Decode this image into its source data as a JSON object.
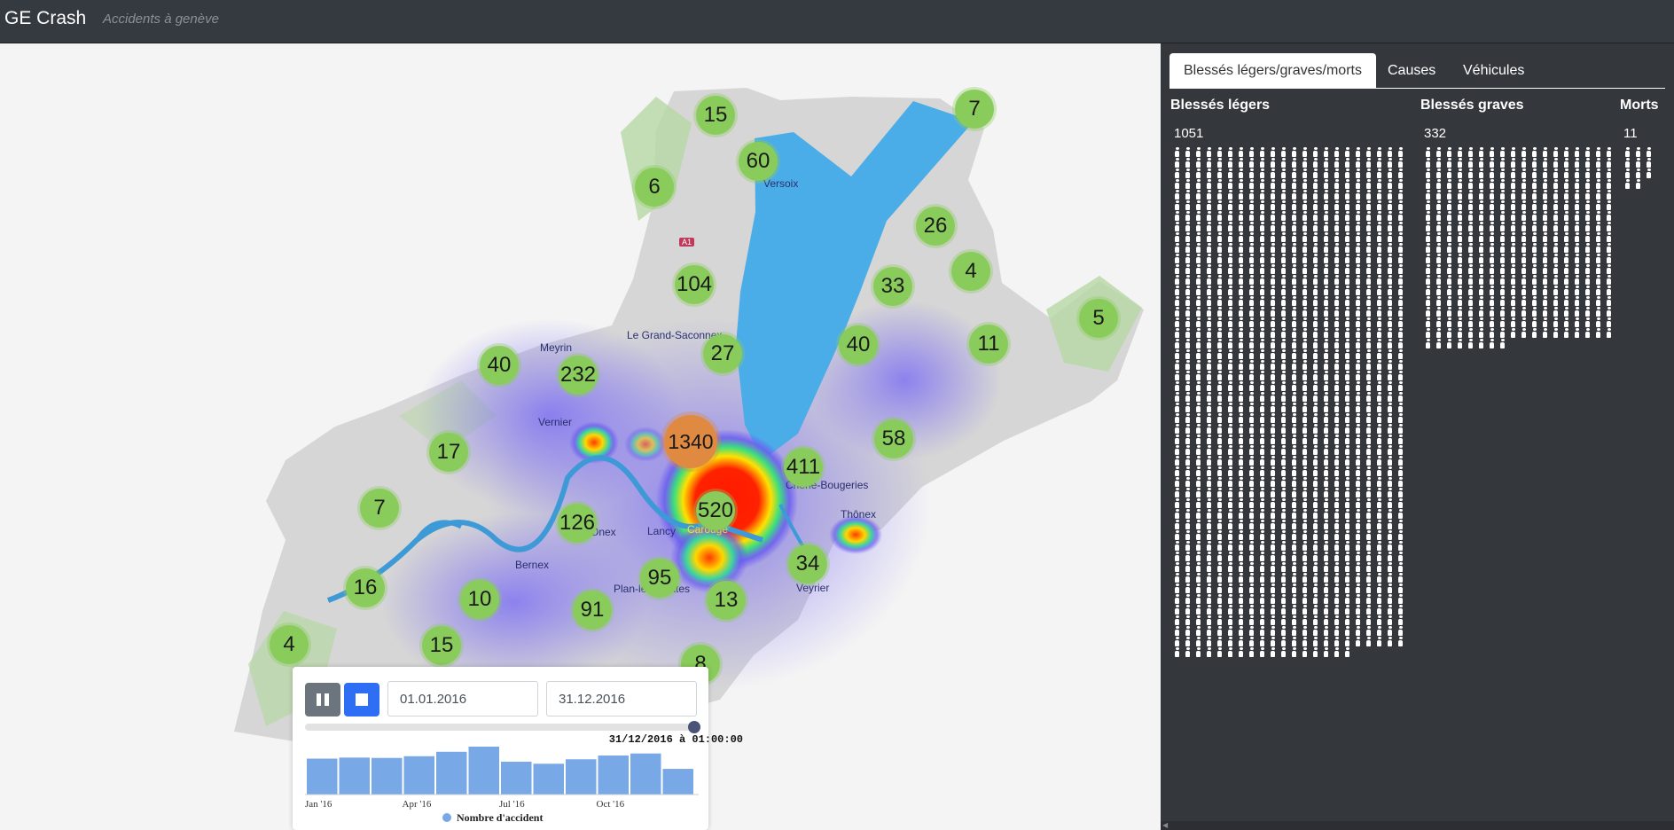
{
  "navbar": {
    "brand": "GE Crash",
    "subtitle": "Accidents à genève"
  },
  "map": {
    "towns": [
      "Versoix",
      "Meyrin",
      "Le Grand-Saconnex",
      "Vernier",
      "Onex",
      "Lancy",
      "Carouge",
      "Chêne-Bougeries",
      "Thônex",
      "Bernex",
      "Plan-les-Ouates",
      "Veyrier"
    ],
    "road_sign": "A1",
    "clusters": [
      15,
      60,
      7,
      6,
      26,
      4,
      104,
      33,
      5,
      27,
      40,
      11,
      40,
      232,
      1340,
      58,
      411,
      17,
      520,
      7,
      126,
      34,
      95,
      16,
      10,
      13,
      91,
      4,
      15,
      8
    ],
    "colors": {
      "cluster": "#89cc5b",
      "cluster_large": "#e08a41",
      "lake": "#4aade8",
      "river": "#3d9ad6"
    }
  },
  "controls": {
    "pause_icon": "pause-icon",
    "stop_icon": "stop-icon",
    "start_date": "01.01.2016",
    "end_date": "31.12.2016",
    "slider_value": 1.0,
    "slider_label": "31/12/2016 à 01:00:00"
  },
  "chart_data": {
    "type": "bar",
    "categories": [
      "Jan '16",
      "Feb '16",
      "Mar '16",
      "Apr '16",
      "May '16",
      "Jun '16",
      "Jul '16",
      "Aug '16",
      "Sep '16",
      "Oct '16",
      "Nov '16",
      "Dec '16"
    ],
    "tick_labels": [
      "Jan '16",
      "Apr '16",
      "Jul '16",
      "Oct '16"
    ],
    "series": [
      {
        "name": "Nombre d'accident",
        "values": [
          105,
          108,
          107,
          112,
          125,
          140,
          96,
          90,
          103,
          114,
          120,
          75
        ]
      }
    ],
    "ylim": [
      0,
      140
    ],
    "color": "#78a8e6",
    "legend": "bottom"
  },
  "panel": {
    "tabs": [
      {
        "label": "Blessés légers/graves/morts",
        "active": true
      },
      {
        "label": "Causes",
        "active": false
      },
      {
        "label": "Véhicules",
        "active": false
      }
    ],
    "columns": [
      {
        "title": "Blessés légers",
        "count": "1051"
      },
      {
        "title": "Blessés graves",
        "count": "332"
      },
      {
        "title": "Morts",
        "count": "11"
      }
    ]
  }
}
